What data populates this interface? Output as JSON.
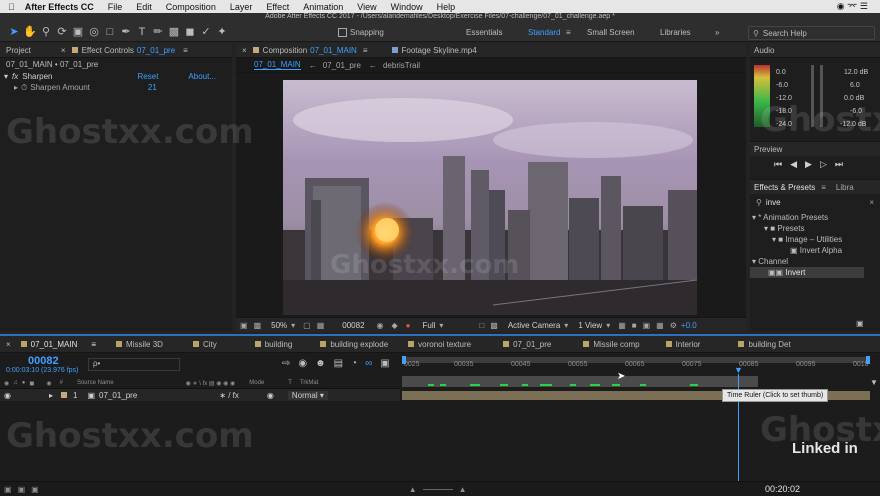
{
  "menubar": {
    "app": "After Effects CC",
    "items": [
      "File",
      "Edit",
      "Composition",
      "Layer",
      "Effect",
      "Animation",
      "View",
      "Window",
      "Help"
    ]
  },
  "title_bar": "Adobe After Effects CC 2017 - /Users/alandemafiles/Desktop/Exercise Files/07-challenge/07_01_challenge.aep *",
  "toolbar": {
    "snapping_label": "Snapping",
    "workspaces": [
      "Essentials",
      "Standard",
      "Small Screen",
      "Libraries"
    ],
    "active_workspace": "Standard",
    "search_placeholder": "Search Help"
  },
  "project_panel": {
    "tab_project": "Project",
    "tab_effect_controls": "Effect Controls",
    "effect_controls_target": "07_01_pre",
    "breadcrumb": "07_01_MAIN • 07_01_pre",
    "effect_name": "Sharpen",
    "reset": "Reset",
    "about": "About...",
    "param_name": "Sharpen Amount",
    "param_value": "21"
  },
  "comp_panel": {
    "tab_label": "Composition",
    "tab_comp": "07_01_MAIN",
    "footage_tab": "Footage Skyline.mp4",
    "crumbs": [
      "07_01_MAIN",
      "07_01_pre",
      "debrisTrail"
    ],
    "zoom": "50%",
    "timecode": "00082",
    "resolution": "Full",
    "camera": "Active Camera",
    "view": "1 View",
    "exposure": "+0.0"
  },
  "audio_panel": {
    "title": "Audio",
    "left_db": [
      "0.0",
      "-6.0",
      "-12.0",
      "-18.0",
      "-24.0"
    ],
    "right_db": [
      "12.0 dB",
      "6.0",
      "0.0 dB",
      "-6.0",
      "-12.0 dB"
    ]
  },
  "preview_panel": {
    "title": "Preview"
  },
  "effects_panel": {
    "tab_effects": "Effects & Presets",
    "tab_libraries": "Libra",
    "search_value": "inve",
    "tree": [
      "* Animation Presets",
      "Presets",
      "Image – Utilities",
      "Invert Alpha",
      "Channel",
      "Invert"
    ]
  },
  "timeline": {
    "main_tab": "07_01_MAIN",
    "tabs": [
      "Missile 3D",
      "City",
      "building",
      "building explode",
      "voronoi texture",
      "07_01_pre",
      "Missile comp",
      "Interior",
      "building Det"
    ],
    "timecode": "00082",
    "subtime": "0:00:03:10 (23.976 fps)",
    "search_placeholder": "ρ•",
    "col_num": "#",
    "col_source": "Source Name",
    "col_mode": "Mode",
    "col_t": "T",
    "col_trkmat": "TrkMat",
    "layer_index": "1",
    "layer_name": "07_01_pre",
    "layer_mode": "Normal",
    "ruler_ticks": [
      "0025",
      "00035",
      "00045",
      "00055",
      "00065",
      "00075",
      "00085",
      "00095",
      "0010"
    ],
    "tooltip": "Time Ruler (Click to set thumb)",
    "current_time_footer": "00:20:02"
  },
  "watermark": "Ghostxx.com",
  "brand": "Linked in"
}
